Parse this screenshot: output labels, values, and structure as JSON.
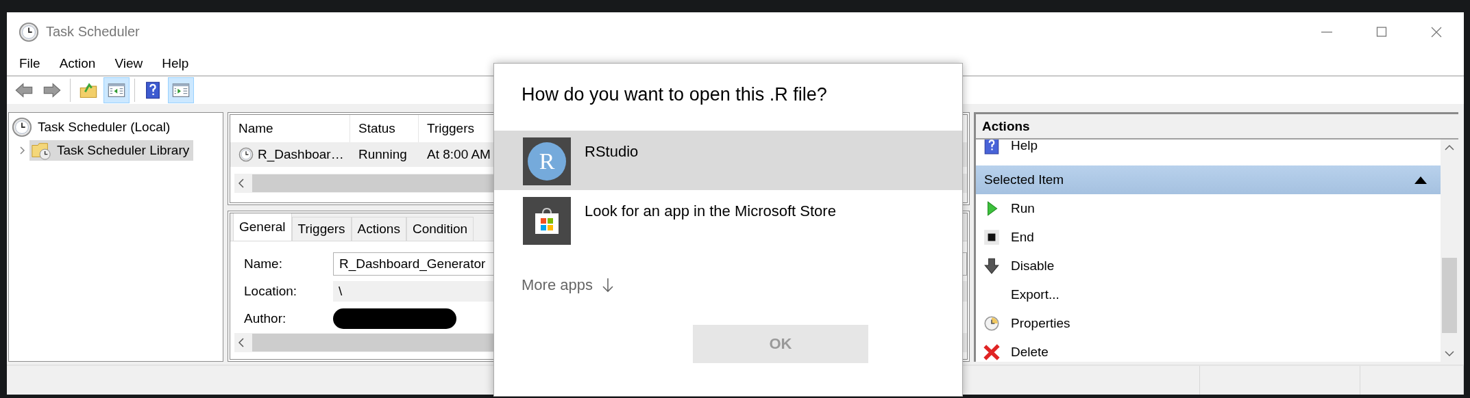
{
  "window": {
    "title": "Task Scheduler"
  },
  "menu": [
    "File",
    "Action",
    "View",
    "Help"
  ],
  "toolbar": [
    {
      "pressed": false
    },
    {
      "pressed": false
    },
    {
      "pressed": false
    },
    {
      "pressed": true
    },
    {
      "pressed": false
    },
    {
      "pressed": true
    }
  ],
  "tree": [
    {
      "label": "Task Scheduler (Local)",
      "selected": false,
      "children": [
        {
          "label": "Task Scheduler Library",
          "selected": true,
          "expanded": false
        }
      ]
    }
  ],
  "task_list": {
    "columns": [
      "Name",
      "Status",
      "Triggers"
    ],
    "rows": [
      {
        "name": "R_Dashboar…",
        "status": "Running",
        "triggers": "At 8:00 AM",
        "selected": true
      }
    ]
  },
  "details": {
    "tabs": [
      {
        "label": "General",
        "selected": true
      },
      {
        "label": "Triggers",
        "selected": false
      },
      {
        "label": "Actions",
        "selected": false
      },
      {
        "label": "Condition",
        "selected": false
      }
    ],
    "fields": [
      {
        "kind": "input",
        "label": "Name:",
        "value": "R_Dashboard_Generator"
      },
      {
        "kind": "readonly",
        "label": "Location:",
        "value": "\\"
      },
      {
        "kind": "redacted",
        "label": "Author:"
      }
    ]
  },
  "actions": {
    "title": "Actions",
    "items": [
      {
        "kind": "help",
        "label": "Help"
      },
      {
        "kind": "section",
        "label": "Selected Item",
        "expanded": true
      },
      {
        "kind": "run",
        "label": "Run"
      },
      {
        "kind": "end",
        "label": "End"
      },
      {
        "kind": "disable",
        "label": "Disable"
      },
      {
        "kind": "plain",
        "label": "Export..."
      },
      {
        "kind": "properties",
        "label": "Properties"
      },
      {
        "kind": "delete",
        "label": "Delete"
      }
    ]
  },
  "dialog": {
    "title": "How do you want to open this .R file?",
    "apps": [
      {
        "kind": "rstudio",
        "name": "RStudio",
        "badge": "R",
        "selected": true
      },
      {
        "kind": "store",
        "name": "Look for an app in the Microsoft Store",
        "selected": false
      }
    ],
    "more_apps": "More apps",
    "ok_button": {
      "label": "OK",
      "disabled": true
    }
  }
}
